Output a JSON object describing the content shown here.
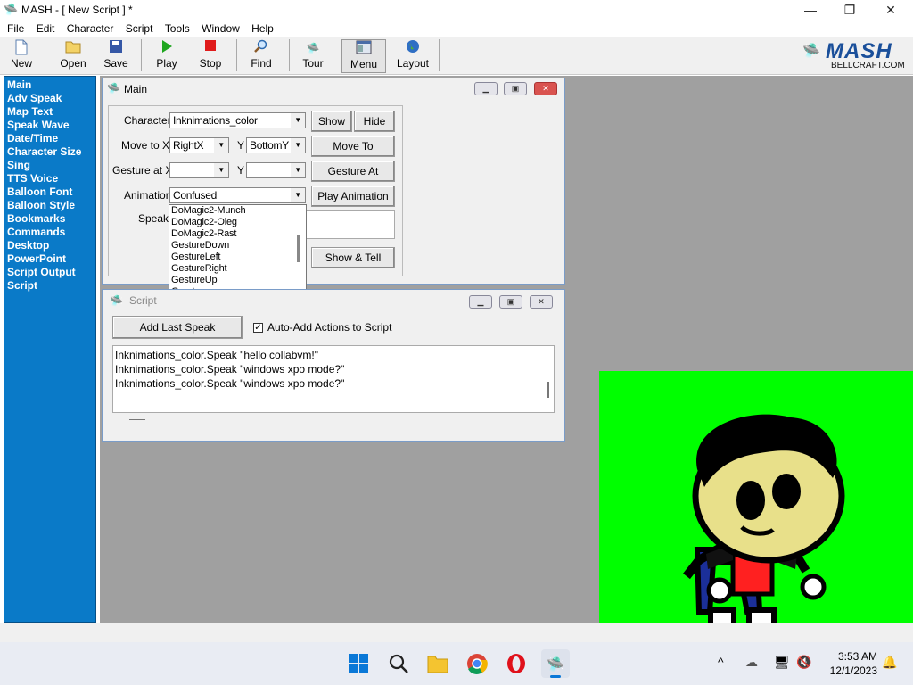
{
  "window": {
    "title": "MASH - [ New Script ] *",
    "minimize": "—",
    "maximize": "❐",
    "close": "✕"
  },
  "menu": [
    "File",
    "Edit",
    "Character",
    "Script",
    "Tools",
    "Window",
    "Help"
  ],
  "toolbar": {
    "buttons": [
      "New",
      "Open",
      "Save",
      "Play",
      "Stop",
      "Find",
      "Tour",
      "Menu",
      "Layout"
    ]
  },
  "logo": {
    "brand": "MASH",
    "sub": "BELLCRAFT.COM"
  },
  "nav": {
    "items": [
      "Main",
      "Adv Speak",
      "Map Text",
      "Speak Wave",
      "Date/Time",
      "Character Size",
      "Sing",
      "TTS Voice",
      "Balloon Font",
      "Balloon Style",
      "Bookmarks",
      "Commands",
      "Desktop",
      "PowerPoint",
      "Script Output",
      "Script"
    ]
  },
  "main_window": {
    "title": "Main",
    "character_label": "Character",
    "character_value": "Inknimations_color",
    "show": "Show",
    "hide": "Hide",
    "move_label": "Move to X",
    "move_x": "RightX",
    "y_label": "Y",
    "move_y": "BottomY",
    "move_to": "Move To",
    "gesture_label": "Gesture at X",
    "gesture_x": "",
    "gesture_y": "",
    "gesture_at": "Gesture At",
    "animation_label": "Animation",
    "animation_value": "Confused",
    "play_animation": "Play Animation",
    "speak_label": "Speak",
    "show_tell": "Show & Tell",
    "dropdown_options": [
      "DoMagic2-Munch",
      "DoMagic2-Oleg",
      "DoMagic2-Rast",
      "GestureDown",
      "GestureLeft",
      "GestureRight",
      "GestureUp",
      "Greet"
    ]
  },
  "script_window": {
    "title": "Script",
    "add_last_speak": "Add Last Speak",
    "auto_add_label": "Auto-Add Actions to Script",
    "auto_add_checked": true,
    "lines": [
      "Inknimations_color.Speak \"hello collabvm!\"",
      "Inknimations_color.Speak \"windows xpo mode?\"",
      "Inknimations_color.Speak \"windows xpo mode?\""
    ]
  },
  "taskbar": {
    "time": "3:53 AM",
    "date": "12/1/2023"
  }
}
